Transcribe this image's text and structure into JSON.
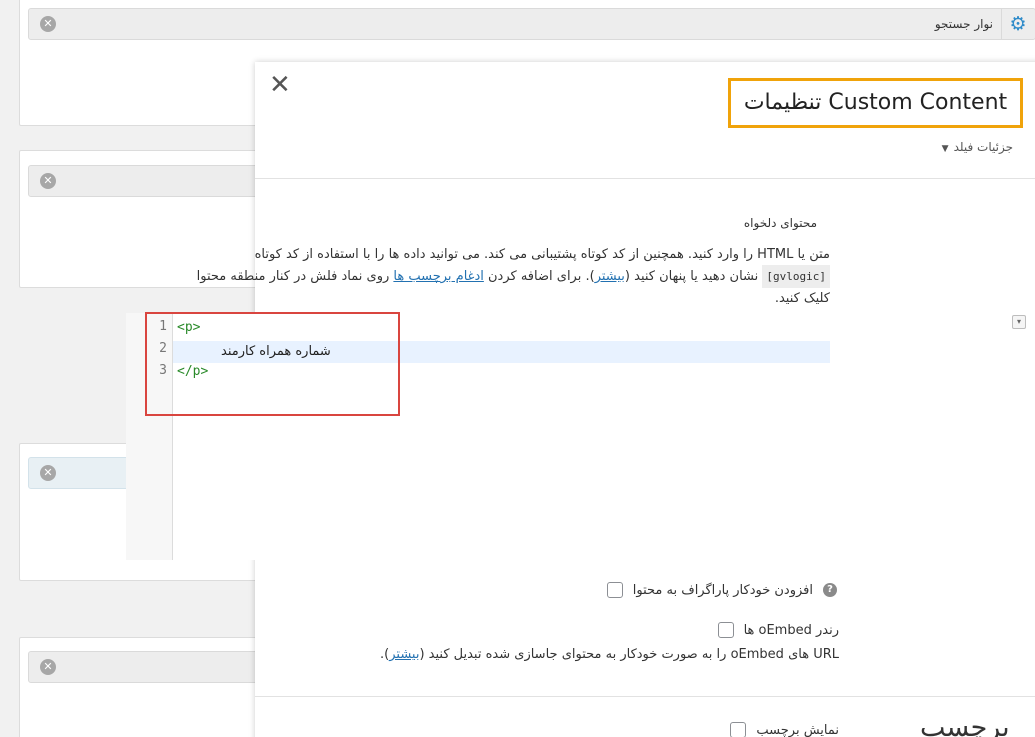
{
  "background": {
    "first_field_title": "نوار جستجو",
    "remove_glyph": "✕",
    "gear_glyph": "⚙"
  },
  "modal": {
    "close_glyph": "✕",
    "title": "Custom Content تنظیمات",
    "field_details": "جزئیات فیلد",
    "field_label": "محتوای دلخواه",
    "desc": {
      "line1": "متن یا HTML را وارد کنید. همچنین از کد کوتاه پشتیبانی می کند. می توانید داده ها را با استفاده از کد کوتاه",
      "code": "[gvlogic]",
      "line2_a": "نشان دهید یا پنهان کنید (",
      "more_link": "بیشتر",
      "line2_b": "). برای اضافه کردن ",
      "merge_link": "ادغام برچسب ها",
      "line2_c": " روی نماد فلش در کنار منطقه محتوا",
      "line3": "کلیک کنید."
    },
    "editor": {
      "line_numbers": [
        "1",
        "2",
        "3"
      ],
      "line1": "<p>",
      "line2": "شماره همراه کارمند",
      "line3": "</p>"
    },
    "checkboxes": {
      "auto_paragraph": "افزودن خودکار پاراگراف به محتوا",
      "help_glyph": "?",
      "oembed": "رندر oEmbed ها",
      "oembed_desc_a": "URL های oEmbed را به صورت خودکار به محتوای جاسازی شده تبدیل کنید (",
      "oembed_more": "بیشتر",
      "oembed_desc_b": ").",
      "show_label": "نمایش برچسب"
    },
    "section_partial": "برچسب"
  }
}
